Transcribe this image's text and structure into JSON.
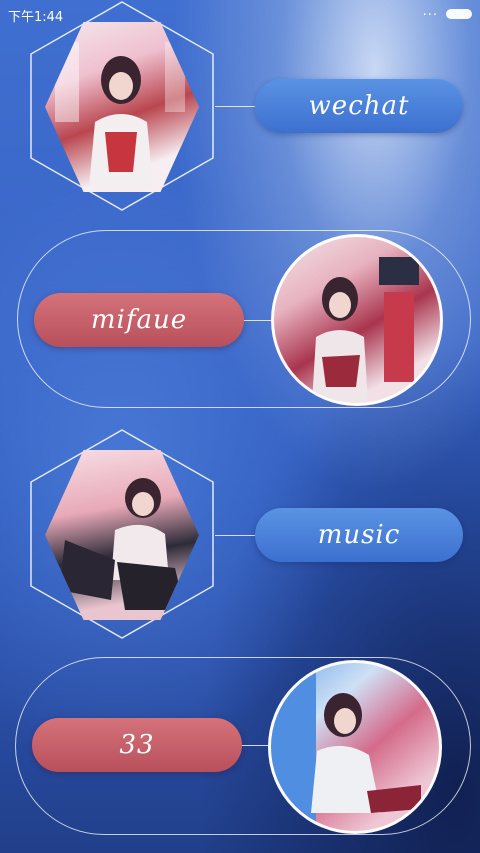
{
  "status_bar": {
    "time": "下午1:44",
    "dots": "..."
  },
  "items": [
    {
      "label": "wechat",
      "shape": "hexagon",
      "pill_color": "#4a80da",
      "photo": "girl-in-subway-car-photo"
    },
    {
      "label": "mifaue",
      "shape": "circle",
      "pill_color": "#c35f69",
      "photo": "girl-on-subway-platform-photo"
    },
    {
      "label": "music",
      "shape": "hexagon",
      "pill_color": "#4a80da",
      "photo": "girl-sitting-with-bag-photo"
    },
    {
      "label": "33",
      "shape": "circle",
      "pill_color": "#c35f69",
      "photo": "girl-sitting-in-tunnel-photo"
    }
  ]
}
